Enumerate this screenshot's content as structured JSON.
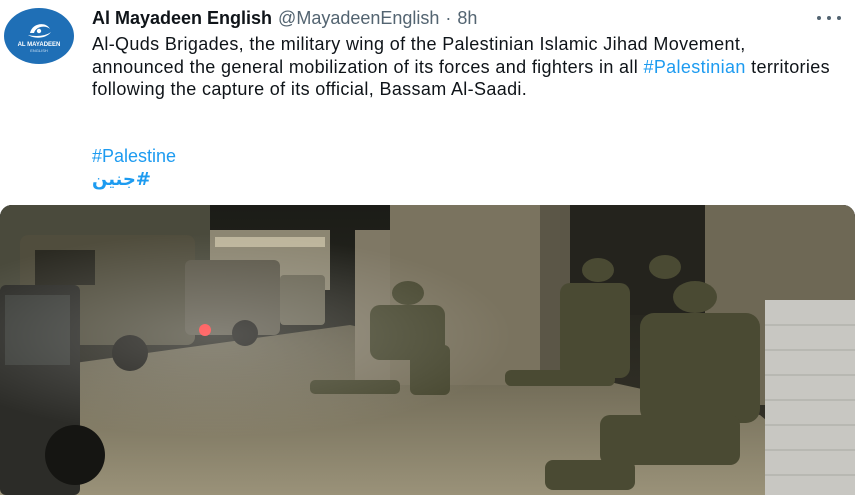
{
  "tweet": {
    "avatar": {
      "brand": "AL MAYADEEN",
      "brand_sub": "ENGLISH",
      "color": "#1f6fb6"
    },
    "author": {
      "name": "Al Mayadeen English",
      "handle": "@MayadeenEnglish",
      "separator": "·",
      "time": "8h"
    },
    "more_icon": "more-horizontal-icon",
    "text": {
      "part1": "Al-Quds Brigades, the military wing of the Palestinian Islamic Jihad Movement, announced the general mobilization of its forces and fighters in all ",
      "hashtag": "#Palestinian",
      "part2": " territories following the capture of its official, Bassam Al-Saadi."
    },
    "hashtags": [
      "#Palestine",
      "#جنين"
    ],
    "link_color": "#1d9bf0",
    "media": {
      "description_icon": "photo"
    }
  }
}
